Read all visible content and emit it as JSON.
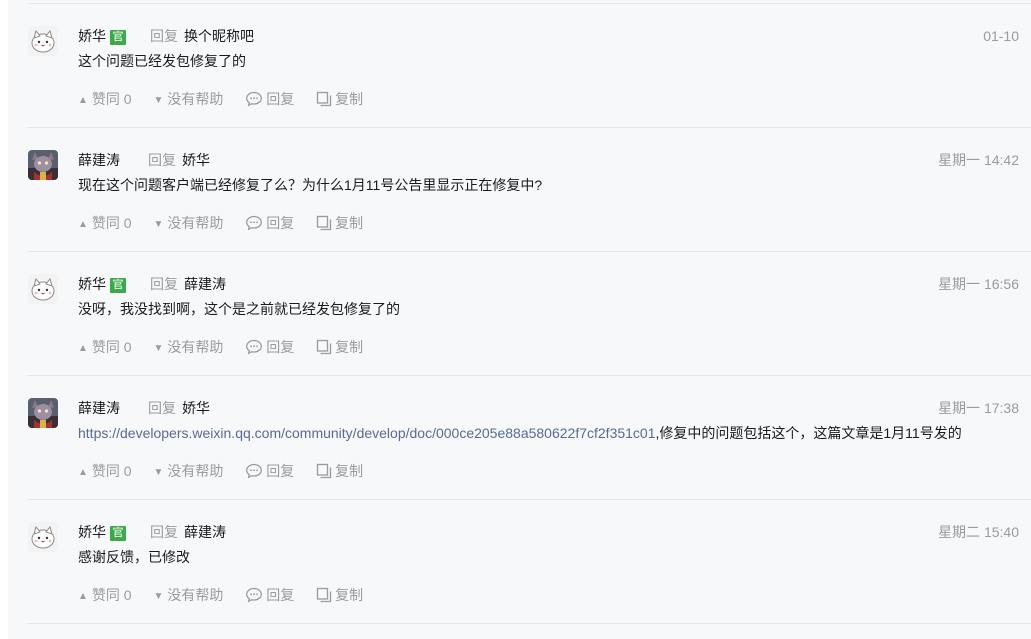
{
  "labels": {
    "reply": "回复",
    "official": "官",
    "upvote": "赞同",
    "not_helpful": "没有帮助",
    "reply_action": "回复",
    "copy": "复制"
  },
  "replies": [
    {
      "author": "娇华",
      "official": true,
      "avatar": "cat-avatar",
      "reply_to": "换个昵称吧",
      "time": "01-10",
      "text": "这个问题已经发包修复了的",
      "link": "",
      "upvotes": "0"
    },
    {
      "author": "薛建涛",
      "official": false,
      "avatar": "character-avatar",
      "reply_to": "娇华",
      "time": "星期一 14:42",
      "text": "现在这个问题客户端已经修复了么？为什么1月11号公告里显示正在修复中?",
      "link": "",
      "upvotes": "0"
    },
    {
      "author": "娇华",
      "official": true,
      "avatar": "cat-avatar",
      "reply_to": "薛建涛",
      "time": "星期一 16:56",
      "text": "没呀，我没找到啊，这个是之前就已经发包修复了的",
      "link": "",
      "upvotes": "0"
    },
    {
      "author": "薛建涛",
      "official": false,
      "avatar": "character-avatar",
      "reply_to": "娇华",
      "time": "星期一 17:38",
      "link": "https://developers.weixin.qq.com/community/develop/doc/000ce205e88a580622f7cf2f351c01",
      "text": ",修复中的问题包括这个，这篇文章是1月11号发的",
      "upvotes": "0"
    },
    {
      "author": "娇华",
      "official": true,
      "avatar": "cat-avatar",
      "reply_to": "薛建涛",
      "time": "星期二 15:40",
      "text": "感谢反馈，已修改",
      "link": "",
      "upvotes": "0"
    }
  ]
}
